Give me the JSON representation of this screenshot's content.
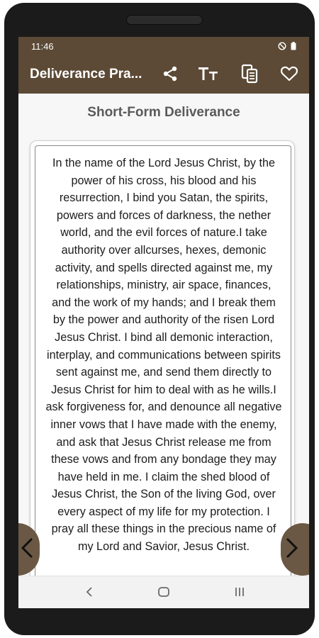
{
  "status_bar": {
    "time": "11:46",
    "icons": [
      "do-not-disturb-icon",
      "battery-icon"
    ]
  },
  "app_bar": {
    "title": "Deliverance Pra...",
    "actions": [
      "share-icon",
      "text-size-icon",
      "copy-icon",
      "heart-icon"
    ],
    "background": "#5c4a36"
  },
  "content": {
    "section_title": "Short-Form Deliverance",
    "prayer": "In the name of the Lord Jesus Christ, by the power of his cross, his blood and his resurrection, I bind you Satan, the spirits, powers and forces of darkness, the nether world, and the evil forces of nature.I take authority over allcurses, hexes, demonic activity, and spells directed against me, my relationships, ministry, air space, finances, and the work of my hands; and I break them by the power and authority of the risen Lord Jesus Christ. I bind all demonic interaction, interplay, and communications between spirits sent against me, and send them directly to Jesus Christ for him to deal with as he wills.I ask forgiveness for, and denounce all negative inner vows that I have made with the enemy, and ask that Jesus Christ release me from these vows and from any bondage they may have held in me. I claim the shed blood of Jesus Christ, the Son of the living God, over every aspect of my life for my protection. I pray all these things in the precious name of my Lord and Savior, Jesus Christ."
  },
  "navigation": {
    "prev_icon": "chevron-left-icon",
    "next_icon": "chevron-right-icon",
    "accent": "#6b5844"
  },
  "system_nav": [
    "back-icon",
    "home-icon",
    "recents-icon"
  ]
}
